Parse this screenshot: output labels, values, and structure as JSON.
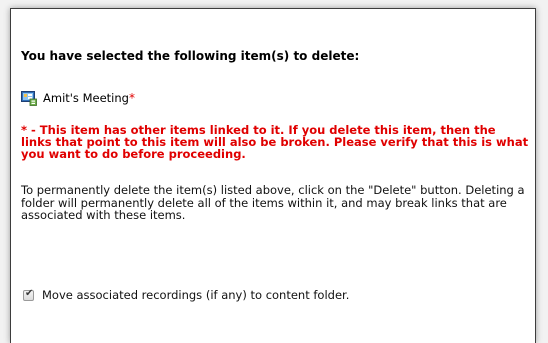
{
  "dialog": {
    "heading": "You have selected the following item(s) to delete:",
    "item": {
      "name": "Amit's Meeting",
      "linked_marker": "*",
      "icon": "meeting-icon"
    },
    "warning": "* - This item has other items linked to it. If you delete this item, then the links that point to this item will also be broken. Please verify that this is what you want to do before proceeding.",
    "instructions": "To permanently delete the item(s) listed above, click on the \"Delete\" button. Deleting a folder will permanently delete all of the items within it, and may break links that are associated with these items.",
    "move_recordings": {
      "label": "Move associated recordings (if any) to content folder.",
      "checked": true
    }
  },
  "colors": {
    "warning": "#e00000",
    "border": "#3d3d3d"
  }
}
